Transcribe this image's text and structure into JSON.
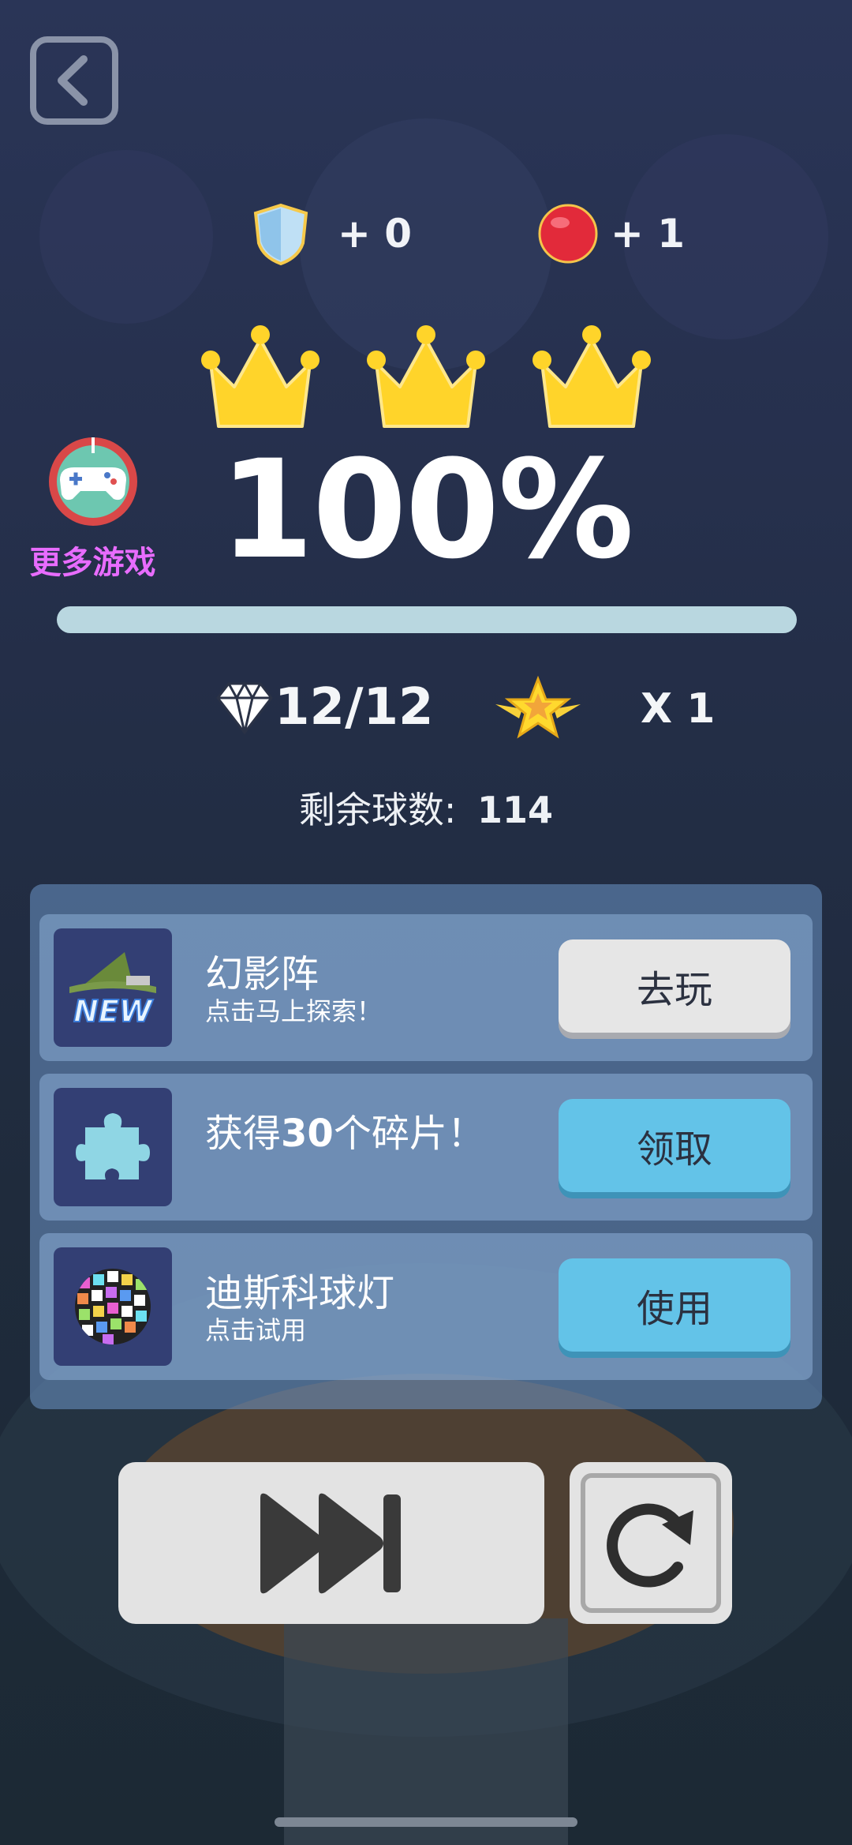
{
  "rewards": {
    "shield_count": "+ 0",
    "ball_count": "+ 1"
  },
  "crowns": {
    "earned": 3,
    "total": 3
  },
  "result": {
    "percent": "100%",
    "progress": 1.0
  },
  "more_games": {
    "label": "更多游戏"
  },
  "stats": {
    "gems": "12/12",
    "star_multiplier": "X 1",
    "remaining_label": "剩余球数:",
    "remaining_value": "114"
  },
  "tasks": [
    {
      "title": "幻影阵",
      "subtitle": "点击马上探索！",
      "button": "去玩",
      "icon": "wizard-new-icon",
      "thumb_text": "NEW"
    },
    {
      "title_parts": [
        "获得",
        "30",
        "个碎片！"
      ],
      "button": "领取",
      "icon": "puzzle-piece-icon"
    },
    {
      "title": "迪斯科球灯",
      "subtitle": "点击试用",
      "button": "使用",
      "icon": "disco-ball-icon"
    }
  ],
  "controls": {
    "skip_icon": "fast-forward-icon",
    "replay_icon": "replay-icon"
  },
  "colors": {
    "accent_blue": "#63c3e8",
    "more_games_pink": "#e86cff",
    "crown_gold": "#ffd42a"
  }
}
